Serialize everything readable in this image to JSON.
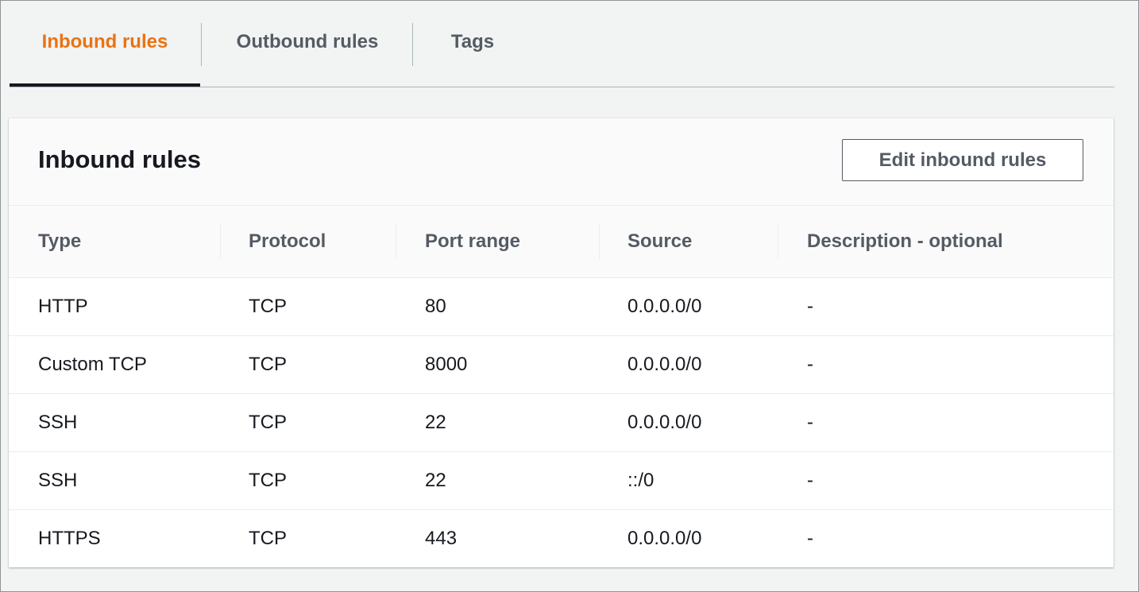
{
  "tabs": [
    {
      "label": "Inbound rules",
      "active": true
    },
    {
      "label": "Outbound rules",
      "active": false
    },
    {
      "label": "Tags",
      "active": false
    }
  ],
  "panel": {
    "title": "Inbound rules",
    "edit_button_label": "Edit inbound rules"
  },
  "table": {
    "columns": [
      "Type",
      "Protocol",
      "Port range",
      "Source",
      "Description - optional"
    ],
    "rows": [
      [
        "HTTP",
        "TCP",
        "80",
        "0.0.0.0/0",
        "-"
      ],
      [
        "Custom TCP",
        "TCP",
        "8000",
        "0.0.0.0/0",
        "-"
      ],
      [
        "SSH",
        "TCP",
        "22",
        "0.0.0.0/0",
        "-"
      ],
      [
        "SSH",
        "TCP",
        "22",
        "::/0",
        "-"
      ],
      [
        "HTTPS",
        "TCP",
        "443",
        "0.0.0.0/0",
        "-"
      ]
    ]
  },
  "colors": {
    "active_tab": "#ec7211",
    "tab_text": "#545b64",
    "background": "#f2f3f3"
  }
}
